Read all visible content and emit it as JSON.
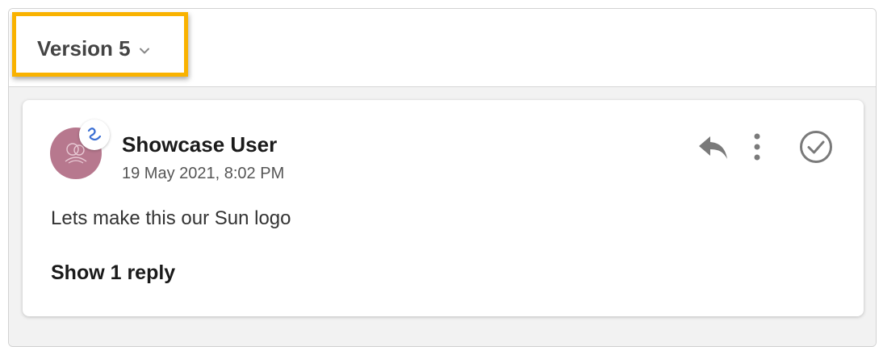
{
  "header": {
    "version_label": "Version 5",
    "highlight_color": "#f9b200"
  },
  "comment": {
    "author": "Showcase User",
    "timestamp": "19 May 2021, 8:02 PM",
    "text": "Lets make this our Sun logo",
    "show_replies_label": "Show 1 reply",
    "avatar_color": "#b7788e",
    "badge_icon": "squiggle-app-icon",
    "actions": [
      "reply-icon",
      "more-vertical-icon",
      "resolve-check-icon"
    ]
  }
}
